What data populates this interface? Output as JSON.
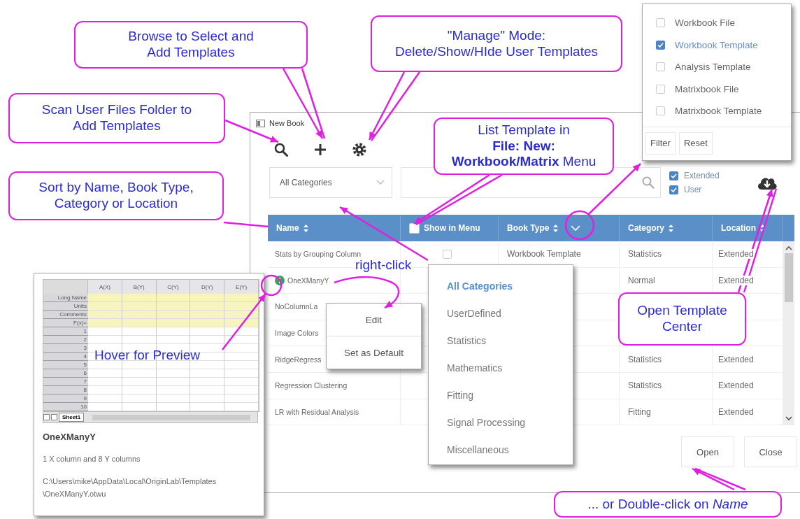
{
  "window": {
    "title": "New Book"
  },
  "category_dropdown": {
    "value": "All Categories"
  },
  "location_filters": [
    {
      "label": "Extended",
      "checked": true
    },
    {
      "label": "User",
      "checked": true
    }
  ],
  "table": {
    "columns": [
      {
        "label": "Name",
        "kind": "sort",
        "filter": false
      },
      {
        "label": "Show in Menu",
        "kind": "checkbox",
        "filter": false
      },
      {
        "label": "Book Type",
        "kind": "sort",
        "filter": true
      },
      {
        "label": "Category",
        "kind": "sort",
        "filter": false
      },
      {
        "label": "Location",
        "kind": "sort",
        "filter": false
      }
    ],
    "rows": [
      {
        "name": "Stats by Grouping Column",
        "info": false,
        "in_menu": false,
        "book_type": "Workbook Template",
        "category": "Statistics",
        "location": "Extended"
      },
      {
        "name": "OneXManyY",
        "info": true,
        "category": "Normal",
        "location": "Extended"
      },
      {
        "name": "NoColumnLa",
        "info": false
      },
      {
        "name": "Image Colors",
        "info": false
      },
      {
        "name": "RidgeRegress",
        "info": false,
        "category": "Statistics",
        "location": "Extended"
      },
      {
        "name": "Regression Clustering",
        "info": false,
        "category": "Statistics",
        "location": "Extended"
      },
      {
        "name": "LR with Residual Analysis",
        "info": false,
        "category": "Fitting",
        "location": "Extended"
      }
    ]
  },
  "buttons": [
    "Open",
    "Close"
  ],
  "type_filter_popup": {
    "items": [
      {
        "label": "Workbook File",
        "checked": false
      },
      {
        "label": "Workbook Template",
        "checked": true
      },
      {
        "label": "Analysis Template",
        "checked": false
      },
      {
        "label": "Matrixbook File",
        "checked": false
      },
      {
        "label": "Matrixbook Template",
        "checked": false
      }
    ],
    "buttons": [
      "Filter",
      "Reset"
    ]
  },
  "category_menu": [
    {
      "label": "All Categories",
      "selected": true
    },
    {
      "label": "UserDefined",
      "selected": false
    },
    {
      "label": "Statistics",
      "selected": false
    },
    {
      "label": "Mathematics",
      "selected": false
    },
    {
      "label": "Fitting",
      "selected": false
    },
    {
      "label": "Signal Processing",
      "selected": false
    },
    {
      "label": "Miscellaneous",
      "selected": false
    }
  ],
  "context_menu": [
    "Edit",
    "Set as Default"
  ],
  "preview": {
    "sheet": {
      "columns": [
        "A(X)",
        "B(Y)",
        "C(Y)",
        "D(Y)",
        "E(Y)"
      ],
      "label_rows": [
        "Long Name",
        "Units",
        "Comments",
        "F(x)="
      ],
      "rows": [
        "1",
        "2",
        "3",
        "4",
        "5",
        "6",
        "7",
        "8",
        "9",
        "10"
      ],
      "tab": "Sheet1"
    },
    "title": "OneXManyY",
    "description": "1 X column and 8 Y columns",
    "path_lines": [
      "C:\\Users\\mike\\AppData\\Local\\OriginLab\\Templates",
      "\\OneXManyY.otwu"
    ]
  },
  "annotations": [
    {
      "kind": "box",
      "text": "Browse to Select and\nAdd Templates"
    },
    {
      "kind": "box",
      "text": "\"Manage\" Mode:\nDelete/Show/HIde User Templates"
    },
    {
      "kind": "box",
      "text": "Scan User Files Folder to\nAdd Templates"
    },
    {
      "kind": "box",
      "text": "List Template in\n**File: New:**\n**Workbook/Matrix** Menu"
    },
    {
      "kind": "box",
      "text": "Sort by Name, Book Type,\nCategory or Location"
    },
    {
      "kind": "box",
      "text": "Open Template\nCenter"
    },
    {
      "kind": "box",
      "text": "... or Double-click on *Name*"
    },
    {
      "kind": "plain",
      "text": "right-click"
    },
    {
      "kind": "plain",
      "text": "Hover for Preview"
    }
  ]
}
